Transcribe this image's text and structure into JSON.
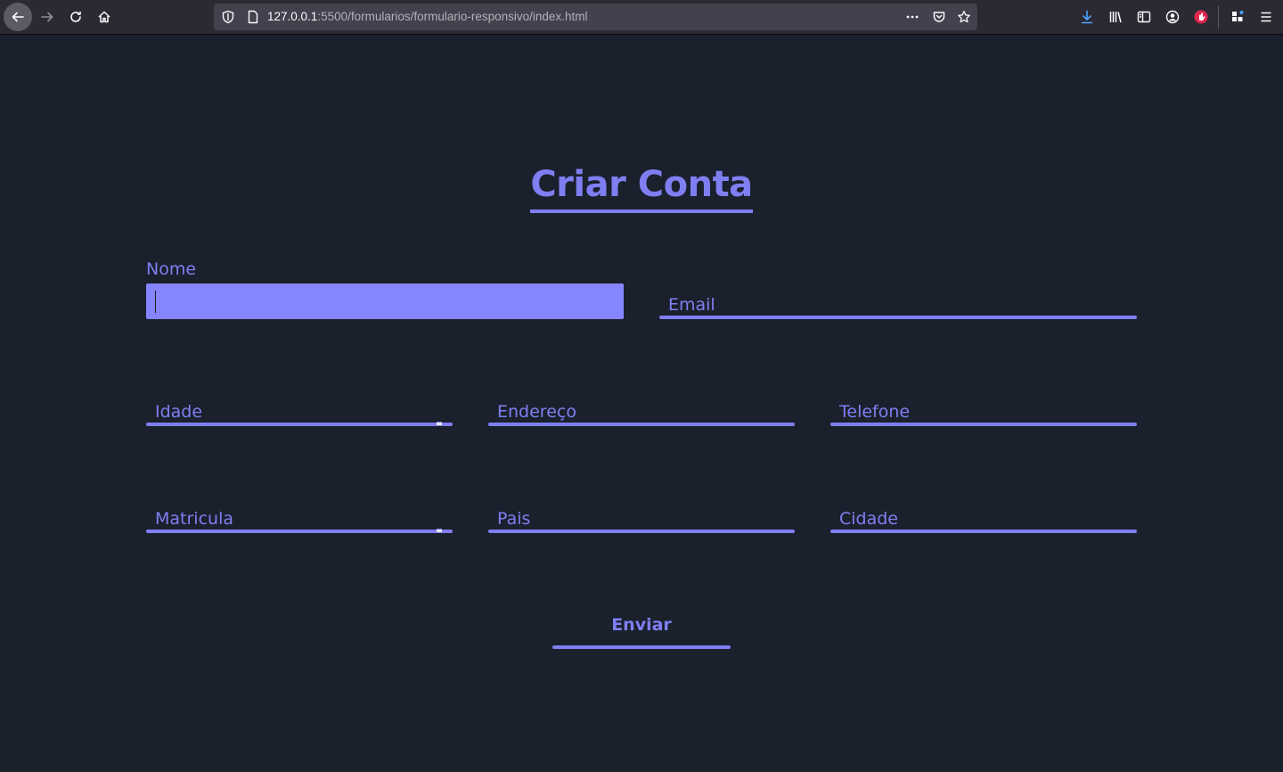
{
  "browser": {
    "url_host": "127.0.0.1",
    "url_path": ":5500/formularios/formulario-responsivo/index.html",
    "icons": [
      "back-icon",
      "forward-icon",
      "reload-icon",
      "home-icon",
      "shield-icon",
      "page-icon",
      "more-icon",
      "pocket-icon",
      "star-icon",
      "download-icon",
      "library-icon",
      "sidebar-icon",
      "account-icon",
      "extension-icon",
      "addons-icon",
      "menu-icon"
    ]
  },
  "form": {
    "title": "Criar Conta",
    "labels": {
      "nome": "Nome",
      "email": "Email",
      "idade": "Idade",
      "endereco": "Endereço",
      "telefone": "Telefone",
      "matricula": "Matricula",
      "pais": "Pais",
      "cidade": "Cidade"
    },
    "submit_label": "Enviar"
  },
  "colors": {
    "background": "#1a202c",
    "accent": "#7f7ff2",
    "active_input": "#8585ff"
  }
}
